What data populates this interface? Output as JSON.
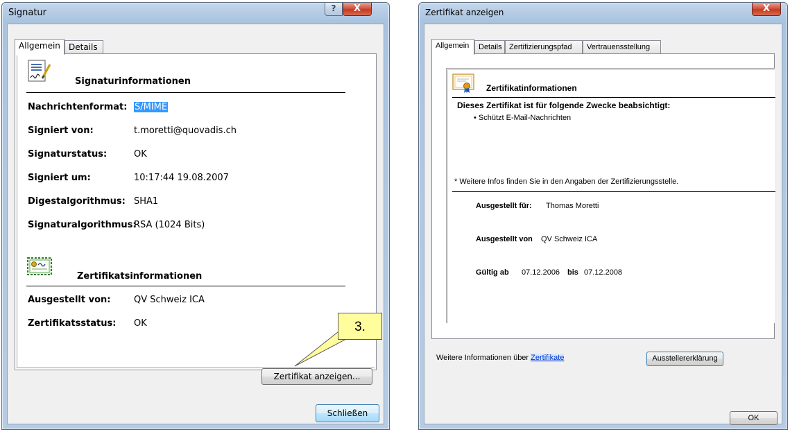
{
  "signature_dialog": {
    "title": "Signatur",
    "help_glyph": "?",
    "close_glyph": "X",
    "tabs": [
      {
        "label": "Allgemein",
        "active": true
      },
      {
        "label": "Details",
        "active": false
      }
    ],
    "signature_section": {
      "icon": "signature-document-icon",
      "title": "Signaturinformationen",
      "rows": [
        {
          "label": "Nachrichtenformat:",
          "value": "S/MIME",
          "highlighted": true
        },
        {
          "label": "Signiert von:",
          "value": "t.moretti@quovadis.ch"
        },
        {
          "label": "Signaturstatus:",
          "value": "OK"
        },
        {
          "label": "Signiert um:",
          "value": "10:17:44 19.08.2007"
        },
        {
          "label": "Digestalgorithmus:",
          "value": "SHA1"
        },
        {
          "label": "Signaturalgorithmus:",
          "value": "RSA (1024 Bits)"
        }
      ]
    },
    "certificate_section": {
      "icon": "certificate-icon",
      "title": "Zertifikatsinformationen",
      "rows": [
        {
          "label": "Ausgestellt von:",
          "value": "QV Schweiz ICA"
        },
        {
          "label": "Zertifikatsstatus:",
          "value": "OK"
        }
      ]
    },
    "view_certificate_button": "Zertifikat anzeigen...",
    "close_button": "Schließen",
    "callout_label": "3."
  },
  "certificate_dialog": {
    "title": "Zertifikat anzeigen",
    "close_glyph": "X",
    "tabs": [
      {
        "label": "Allgemein",
        "active": true
      },
      {
        "label": "Details",
        "active": false
      },
      {
        "label": "Zertifizierungspfad",
        "active": false
      },
      {
        "label": "Vertrauensstellung",
        "active": false
      }
    ],
    "info_icon": "certificate-ribbon-icon",
    "info_title": "Zertifikatinformationen",
    "purpose_heading": "Dieses Zertifikat ist für folgende Zwecke beabsichtigt:",
    "purposes": [
      "• Schützt E-Mail-Nachrichten"
    ],
    "footnote": "* Weitere Infos finden Sie in den Angaben der Zertifizierungsstelle.",
    "issued_to_label": "Ausgestellt für:",
    "issued_to_value": "Thomas Moretti",
    "issued_by_label": "Ausgestellt von",
    "issued_by_value": "QV Schweiz ICA",
    "valid_from_label": "Gültig ab",
    "valid_from_value": "07.12.2006",
    "valid_to_label": "bis",
    "valid_to_value": "07.12.2008",
    "issuer_statement_button": "Ausstellererklärung",
    "more_info_text": "Weitere Informationen über",
    "more_info_link": "Zertifikate",
    "ok_button": "OK"
  }
}
